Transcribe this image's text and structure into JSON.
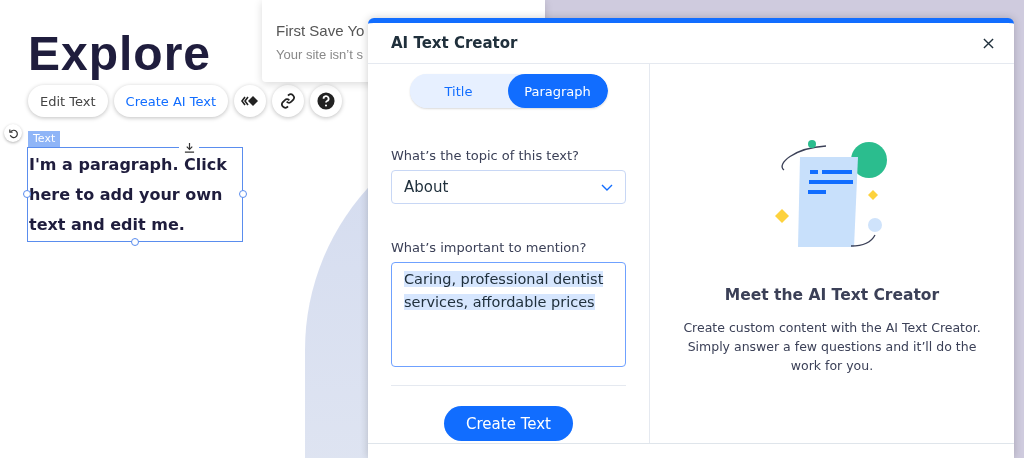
{
  "canvas": {
    "heading": "Explore",
    "element_tag": "Text",
    "paragraph": "I'm a paragraph. Click here to add your own text and edit me."
  },
  "toolbar": {
    "buttons": [
      {
        "label": "Edit Text",
        "kind": "plain"
      },
      {
        "label": "Create AI Text",
        "kind": "accent"
      }
    ]
  },
  "toast": {
    "title": "First Save Yo",
    "message": "Your site isn’t s"
  },
  "dialog": {
    "title": "AI Text Creator",
    "tabs": [
      {
        "label": "Title",
        "selected": false
      },
      {
        "label": "Paragraph",
        "selected": true
      }
    ],
    "topic": {
      "label": "What’s the topic of this text?",
      "value": "About"
    },
    "mention": {
      "label": "What’s important to mention?",
      "value": "Caring, professional dentist services, affordable prices"
    },
    "submit": "Create Text",
    "intro": {
      "heading": "Meet the AI Text Creator",
      "text": "Create custom content with the AI Text Creator. Simply answer a few questions and it’ll do the work for you."
    }
  }
}
